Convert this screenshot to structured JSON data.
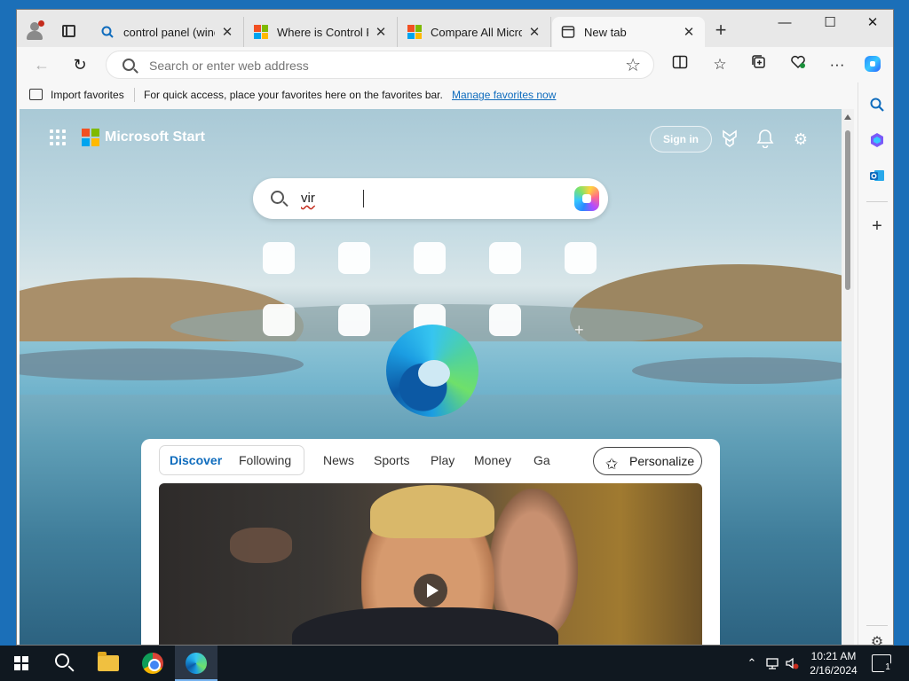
{
  "browser": {
    "tabs": [
      {
        "title": "control panel (windo",
        "icon": "search-icon",
        "active": false
      },
      {
        "title": "Where is Control Pa",
        "icon": "microsoft-logo-icon",
        "active": false
      },
      {
        "title": "Compare All Microso",
        "icon": "microsoft-logo-icon",
        "active": false
      },
      {
        "title": "New tab",
        "icon": "new-tab-page-icon",
        "active": true
      }
    ],
    "address_placeholder": "Search or enter web address",
    "favorites_bar": {
      "import_label": "Import favorites",
      "message": "For quick access, place your favorites here on the favorites bar.",
      "manage_link": "Manage favorites now"
    },
    "colors": {
      "link": "#0f6cbd",
      "accent": "#0f6cbd",
      "microsoft_red": "#f25022",
      "microsoft_green": "#7fba00",
      "microsoft_blue": "#00a4ef",
      "microsoft_yellow": "#ffb900"
    }
  },
  "newtab": {
    "brand": "Microsoft Start",
    "sign_in": "Sign in",
    "search_query": "vir",
    "feed": {
      "pill_tabs": [
        "Discover",
        "Following"
      ],
      "active_tab": "Discover",
      "categories": [
        "News",
        "Sports",
        "Play",
        "Money",
        "Ga"
      ],
      "personalize_label": "Personalize"
    }
  },
  "taskbar": {
    "time": "10:21 AM",
    "date": "2/16/2024",
    "notification_count": "1"
  }
}
